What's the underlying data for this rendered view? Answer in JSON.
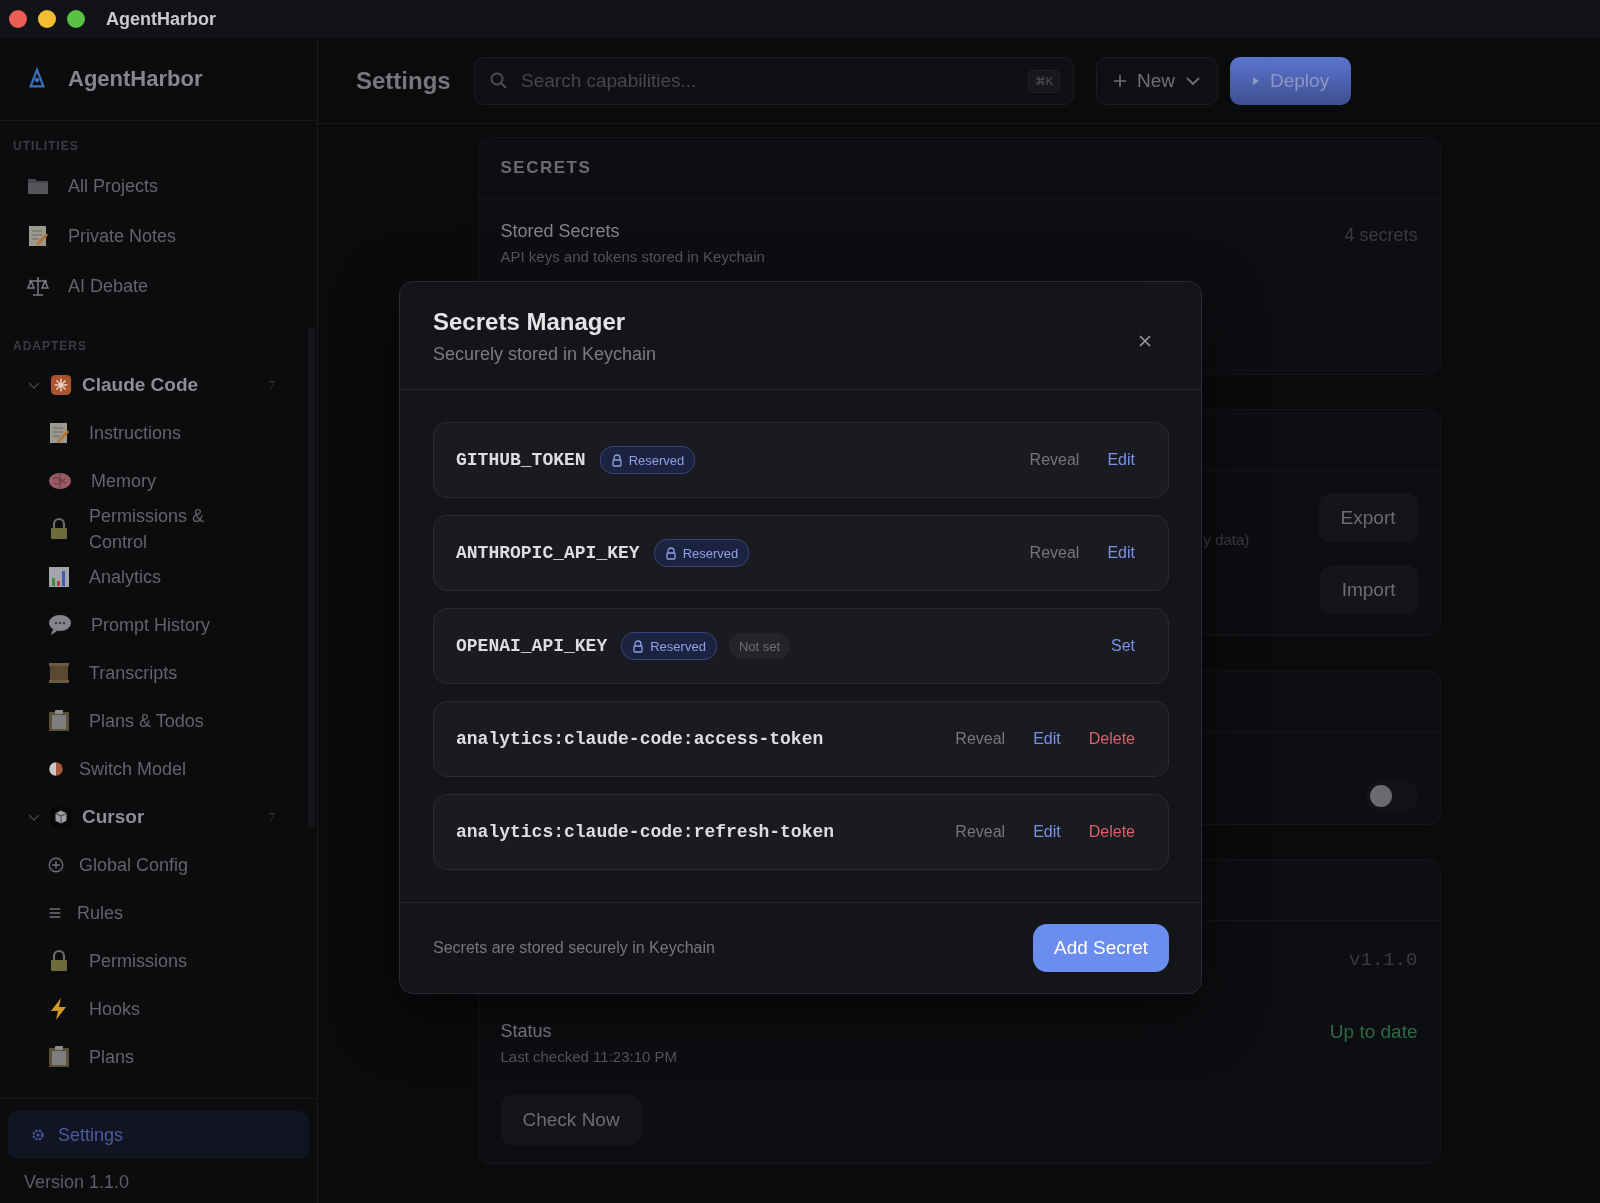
{
  "window": {
    "title": "AgentHarbor"
  },
  "sidebar": {
    "brand": "AgentHarbor",
    "utilities": {
      "heading": "UTILITIES",
      "items": [
        {
          "label": "All Projects",
          "selected": false
        },
        {
          "label": "Private Notes",
          "selected": false
        },
        {
          "label": "AI Debate",
          "selected": false
        }
      ]
    },
    "adapters": {
      "heading": "ADAPTERS",
      "items": [
        {
          "label": "Claude Code",
          "count": "7",
          "expanded": true,
          "children": [
            {
              "label": "Instructions",
              "selected": false
            },
            {
              "label": "Memory",
              "selected": false
            },
            {
              "label": "Permissions & Control",
              "selected": false
            },
            {
              "label": "Analytics",
              "selected": false
            },
            {
              "label": "Prompt History",
              "selected": false
            },
            {
              "label": "Transcripts",
              "selected": false
            },
            {
              "label": "Plans & Todos",
              "selected": false
            },
            {
              "label": "Switch Model",
              "selected": false
            }
          ]
        },
        {
          "label": "Cursor",
          "count": "7",
          "expanded": true,
          "children": [
            {
              "label": "Global Config",
              "selected": false
            },
            {
              "label": "Rules",
              "selected": false
            },
            {
              "label": "Permissions",
              "selected": false
            },
            {
              "label": "Hooks",
              "selected": false
            },
            {
              "label": "Plans",
              "selected": false
            }
          ]
        }
      ]
    },
    "settings": {
      "label": "Settings",
      "selected": true
    },
    "version": "Version 1.1.0"
  },
  "header": {
    "title": "Settings",
    "search": {
      "placeholder": "Search capabilities...",
      "shortcut": "⌘K"
    },
    "new_button": "New",
    "deploy_button": "Deploy"
  },
  "cards": [
    {
      "kind": "secrets",
      "heading": "SECRETS",
      "title": "Stored Secrets",
      "subtitle": "API keys and tokens stored in Keychain",
      "value": "4 secrets"
    },
    {
      "kind": "backup",
      "note": "y data)",
      "buttons": [
        "Export",
        "Import"
      ]
    },
    {
      "kind": "toggle",
      "toggle": {
        "on": false
      }
    },
    {
      "kind": "updates",
      "version": "v1.1.0",
      "title": "Status",
      "subtitle": "Last checked 11:23:10 PM",
      "status": "Up to date",
      "button": "Check Now"
    }
  ],
  "modal": {
    "title": "Secrets Manager",
    "subtitle": "Securely stored in Keychain",
    "secrets": [
      {
        "name": "GITHUB_TOKEN",
        "badge": "Reserved",
        "actions": [
          {
            "label": "Reveal",
            "kind": "reveal"
          },
          {
            "label": "Edit",
            "kind": "edit"
          }
        ]
      },
      {
        "name": "ANTHROPIC_API_KEY",
        "badge": "Reserved",
        "actions": [
          {
            "label": "Reveal",
            "kind": "reveal"
          },
          {
            "label": "Edit",
            "kind": "edit"
          }
        ]
      },
      {
        "name": "OPENAI_API_KEY",
        "badge": "Reserved",
        "status": "Not set",
        "actions": [
          {
            "label": "Set",
            "kind": "set"
          }
        ]
      },
      {
        "name": "analytics:claude-code:access-token",
        "actions": [
          {
            "label": "Reveal",
            "kind": "reveal"
          },
          {
            "label": "Edit",
            "kind": "edit"
          },
          {
            "label": "Delete",
            "kind": "delete"
          }
        ]
      },
      {
        "name": "analytics:claude-code:refresh-token",
        "actions": [
          {
            "label": "Reveal",
            "kind": "reveal"
          },
          {
            "label": "Edit",
            "kind": "edit"
          },
          {
            "label": "Delete",
            "kind": "delete"
          }
        ]
      }
    ],
    "footer_note": "Secrets are stored securely in Keychain",
    "add_button": "Add Secret"
  }
}
